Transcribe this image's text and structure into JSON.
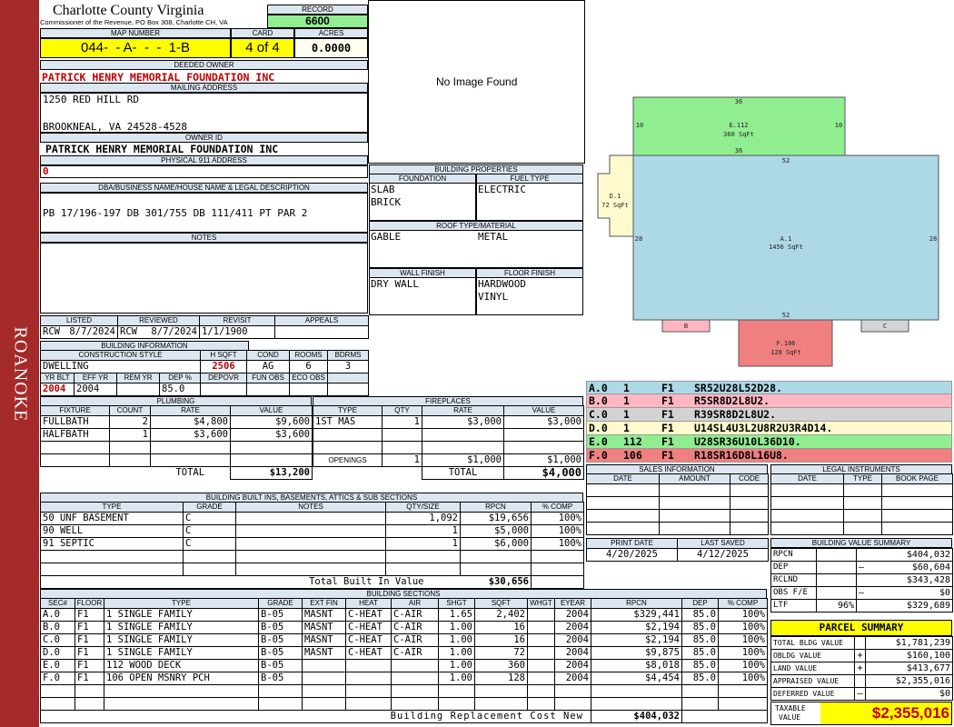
{
  "side_label": "ROANOKE",
  "county": {
    "title": "Charlotte County Virginia",
    "subtitle": "Commissioner of the Revenue, PO Box 308, Charlotte CH, VA"
  },
  "record": {
    "label": "RECORD",
    "value": "6600"
  },
  "map": {
    "label": "MAP NUMBER",
    "value": "044-  - A-  -  -  1-B"
  },
  "card": {
    "label": "CARD",
    "value": "4 of 4"
  },
  "acres": {
    "label": "ACRES",
    "value": "0.0000"
  },
  "deeded_owner": {
    "label": "DEEDED OWNER",
    "value": "PATRICK HENRY MEMORIAL FOUNDATION INC"
  },
  "mailing": {
    "label": "MAILING ADDRESS",
    "line1": "1250 RED HILL RD",
    "line2": "BROOKNEAL, VA 24528-4528"
  },
  "owner_id": {
    "label": "OWNER ID",
    "value": "PATRICK HENRY MEMORIAL FOUNDATION INC"
  },
  "physical": {
    "label": "PHYSICAL 911 ADDRESS",
    "value": "0"
  },
  "legal": {
    "label": "DBA/BUSINESS NAME/HOUSE NAME & LEGAL DESCRIPTION",
    "value": "PB 17/196-197 DB 301/755 DB 111/411 PT PAR 2"
  },
  "notes": {
    "label": "NOTES",
    "value": ""
  },
  "image": {
    "text": "No Image Found"
  },
  "building_props": {
    "label": "BUILDING PROPERTIES",
    "foundation_label": "FOUNDATION",
    "fuel_label": "FUEL TYPE",
    "foundation1": "SLAB",
    "foundation2": "BRICK",
    "fuel": "ELECTRIC",
    "roof_label": "ROOF TYPE/MATERIAL",
    "roof_type": "GABLE",
    "roof_material": "METAL",
    "wall_label": "WALL FINISH",
    "floor_label": "FLOOR FINISH",
    "wall": "DRY WALL",
    "floor1": "HARDWOOD",
    "floor2": "VINYL"
  },
  "review": {
    "listed_label": "LISTED",
    "reviewed_label": "REVIEWED",
    "revisit_label": "REVISIT",
    "appeals_label": "APPEALS",
    "listed_by": "RCW",
    "listed_date": "8/7/2024",
    "reviewed_by": "RCW",
    "reviewed_date": "8/7/2024",
    "revisit": "1/1/1900",
    "appeals": ""
  },
  "building_info": {
    "label": "BUILDING INFORMATION",
    "style_label": "CONSTRUCTION STYLE",
    "hsqft_label": "H SQFT",
    "cond_label": "COND",
    "rooms_label": "ROOMS",
    "bdrms_label": "BDRMS",
    "style": "DWELLING",
    "hsqft": "2506",
    "cond": "AG",
    "rooms": "6",
    "bdrms": "3",
    "yrblt_label": "YR BLT",
    "effyr_label": "EFF YR",
    "remyr_label": "REM YR",
    "dep_label": "DEP %",
    "depovr_label": "DEPOVR",
    "funobs_label": "FUN OBS",
    "ecoobs_label": "ECO OBS",
    "yrblt": "2004",
    "effyr": "2004",
    "remyr": "",
    "dep": "85.0",
    "depovr": "",
    "funobs": "",
    "ecoobs": ""
  },
  "plumbing": {
    "label": "PLUMBING",
    "headers": [
      "FIXTURE",
      "COUNT",
      "RATE",
      "VALUE"
    ],
    "rows": [
      [
        "FULLBATH",
        "2",
        "$4,800",
        "$9,600"
      ],
      [
        "HALFBATH",
        "1",
        "$3,600",
        "$3,600"
      ]
    ],
    "total_label": "TOTAL",
    "total": "$13,200"
  },
  "fireplaces": {
    "label": "FIREPLACES",
    "headers": [
      "TYPE",
      "QTY",
      "RATE",
      "VALUE"
    ],
    "rows": [
      [
        "1ST MAS",
        "1",
        "$3,000",
        "$3,000"
      ]
    ],
    "openings_label": "OPENINGS",
    "openings_qty": "1",
    "openings_rate": "$1,000",
    "openings_value": "$1,000",
    "total_label": "TOTAL",
    "total": "$4,000"
  },
  "builtins": {
    "label": "BUILDING BUILT INS, BASEMENTS, ATTICS & SUB SECTIONS",
    "headers": [
      "TYPE",
      "GRADE",
      "NOTES",
      "QTY/SIZE",
      "RPCN",
      "% COMP"
    ],
    "rows": [
      [
        "50 UNF BASEMENT",
        "C",
        "",
        "1,092",
        "$19,656",
        "100%"
      ],
      [
        "90 WELL",
        "C",
        "",
        "1",
        "$5,000",
        "100%"
      ],
      [
        "91 SEPTIC",
        "C",
        "",
        "1",
        "$6,000",
        "100%"
      ]
    ],
    "total_label": "Total Built In Value",
    "total": "$30,656"
  },
  "sections": {
    "label": "BUILDING SECTIONS",
    "headers": [
      "SEC#",
      "FLOOR",
      "TYPE",
      "GRADE",
      "EXT FIN",
      "HEAT",
      "AIR",
      "SHGT",
      "SQFT",
      "WHGT",
      "EYEAR",
      "RPCN",
      "DEP",
      "% COMP"
    ],
    "rows": [
      [
        "A.0",
        "F1",
        "1 SINGLE FAMILY",
        "B-05",
        "MASNT",
        "C-HEAT",
        "C-AIR",
        "1.65",
        "2,402",
        "",
        "2004",
        "$329,441",
        "85.0",
        "100%"
      ],
      [
        "B.0",
        "F1",
        "1 SINGLE FAMILY",
        "B-05",
        "MASNT",
        "C-HEAT",
        "C-AIR",
        "1.00",
        "16",
        "",
        "2004",
        "$2,194",
        "85.0",
        "100%"
      ],
      [
        "C.0",
        "F1",
        "1 SINGLE FAMILY",
        "B-05",
        "MASNT",
        "C-HEAT",
        "C-AIR",
        "1.00",
        "16",
        "",
        "2004",
        "$2,194",
        "85.0",
        "100%"
      ],
      [
        "D.0",
        "F1",
        "1 SINGLE FAMILY",
        "B-05",
        "MASNT",
        "C-HEAT",
        "C-AIR",
        "1.00",
        "72",
        "",
        "2004",
        "$9,875",
        "85.0",
        "100%"
      ],
      [
        "E.0",
        "F1",
        "112 WOOD DECK",
        "B-05",
        "",
        "",
        "",
        "1.00",
        "360",
        "",
        "2004",
        "$8,018",
        "85.0",
        "100%"
      ],
      [
        "F.0",
        "F1",
        "106 OPEN MSNRY PCH",
        "B-05",
        "",
        "",
        "",
        "1.00",
        "128",
        "",
        "2004",
        "$4,454",
        "85.0",
        "100%"
      ]
    ],
    "total_label": "Building Replacement Cost New",
    "total": "$404,032"
  },
  "sketch": {
    "a": {
      "code": "A.1",
      "area": "1456 SqFt",
      "top": "52",
      "bottom": "52",
      "left": "28",
      "right": "28"
    },
    "e": {
      "code": "E.112",
      "area": "360 SqFt",
      "top": "36",
      "bottom": "36",
      "left": "10",
      "right": "10"
    },
    "d": {
      "code": "D.1",
      "area": "72 SqFt"
    },
    "f": {
      "code": "F.106",
      "area": "128 SqFt"
    },
    "b": {
      "code": "B"
    },
    "c": {
      "code": "C"
    }
  },
  "legend": [
    {
      "sec": "A.0",
      "num": "1",
      "floor": "F1",
      "code": "SR52U28L52D28.",
      "color": "#add8e6"
    },
    {
      "sec": "B.0",
      "num": "1",
      "floor": "F1",
      "code": "R5SR8D2L8U2.",
      "color": "#ffb6c1"
    },
    {
      "sec": "C.0",
      "num": "1",
      "floor": "F1",
      "code": "R39SR8D2L8U2.",
      "color": "#d3d3d3"
    },
    {
      "sec": "D.0",
      "num": "1",
      "floor": "F1",
      "code": "U14SL4U3L2U8R2U3R4D14.",
      "color": "#fffacd"
    },
    {
      "sec": "E.0",
      "num": "112",
      "floor": "F1",
      "code": "U28SR36U10L36D10.",
      "color": "#90ee90"
    },
    {
      "sec": "F.0",
      "num": "106",
      "floor": "F1",
      "code": "R18SR16D8L16U8.",
      "color": "#f08080"
    }
  ],
  "sales": {
    "label": "SALES INFORMATION",
    "headers": [
      "DATE",
      "AMOUNT",
      "CODE"
    ]
  },
  "legal_instruments": {
    "label": "LEGAL INSTRUMENTS",
    "headers": [
      "DATE",
      "TYPE",
      "BOOK PAGE"
    ]
  },
  "print": {
    "print_label": "PRINT DATE",
    "saved_label": "LAST SAVED",
    "print_date": "4/20/2025",
    "saved_date": "4/12/2025"
  },
  "value_summary": {
    "label": "BUILDING VALUE SUMMARY",
    "rows": [
      {
        "label": "RPCN",
        "sign": "",
        "pct": "",
        "value": "$404,032"
      },
      {
        "label": "DEP",
        "sign": "–",
        "pct": "",
        "value": "$60,604"
      },
      {
        "label": "RCLND",
        "sign": "",
        "pct": "",
        "value": "$343,428"
      },
      {
        "label": "OBS F/E",
        "sign": "–",
        "pct": "",
        "value": "$0"
      },
      {
        "label": "LTF",
        "sign": "",
        "pct": "96%",
        "value": "$329,689"
      }
    ]
  },
  "parcel": {
    "label": "PARCEL SUMMARY",
    "rows": [
      {
        "label": "TOTAL BLDG VALUE",
        "sign": "",
        "value": "$1,781,239"
      },
      {
        "label": "OBLDG VALUE",
        "sign": "+",
        "value": "$160,100"
      },
      {
        "label": "LAND VALUE",
        "sign": "+",
        "value": "$413,677"
      },
      {
        "label": "APPRAISED VALUE",
        "sign": "",
        "value": "$2,355,016"
      },
      {
        "label": "DEFERRED VALUE",
        "sign": "–",
        "value": "$0"
      }
    ],
    "taxable_label1": "TAXABLE",
    "taxable_label2": "VALUE",
    "taxable": "$2,355,016"
  }
}
